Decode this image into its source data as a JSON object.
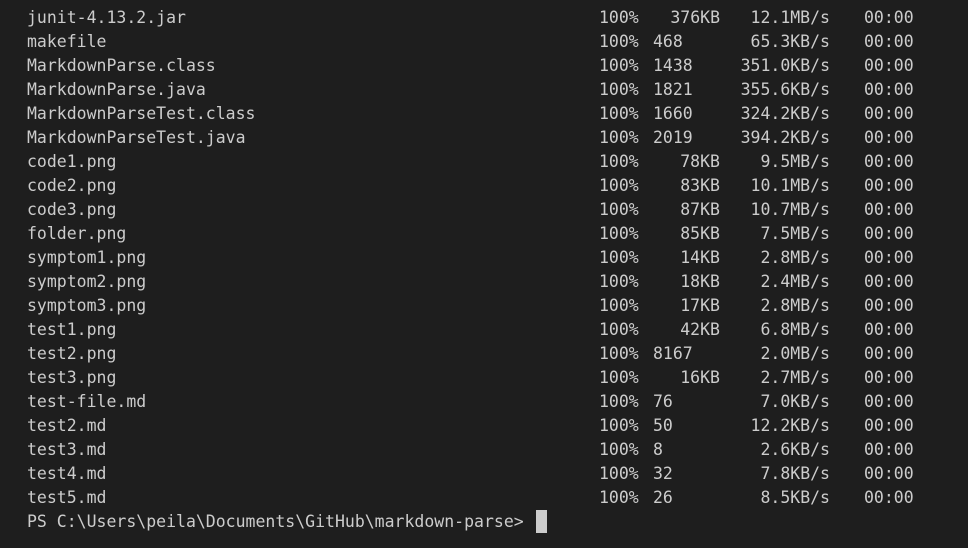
{
  "terminal": {
    "files": [
      {
        "name": "junit-4.13.2.jar",
        "percent": "100%",
        "size": "376KB",
        "rate": "12.1MB/s",
        "time": "00:00"
      },
      {
        "name": "makefile",
        "percent": "100%",
        "size": "468",
        "rate": "65.3KB/s",
        "time": "00:00"
      },
      {
        "name": "MarkdownParse.class",
        "percent": "100%",
        "size": "1438",
        "rate": "351.0KB/s",
        "time": "00:00"
      },
      {
        "name": "MarkdownParse.java",
        "percent": "100%",
        "size": "1821",
        "rate": "355.6KB/s",
        "time": "00:00"
      },
      {
        "name": "MarkdownParseTest.class",
        "percent": "100%",
        "size": "1660",
        "rate": "324.2KB/s",
        "time": "00:00"
      },
      {
        "name": "MarkdownParseTest.java",
        "percent": "100%",
        "size": "2019",
        "rate": "394.2KB/s",
        "time": "00:00"
      },
      {
        "name": "code1.png",
        "percent": "100%",
        "size": "78KB",
        "rate": "9.5MB/s",
        "time": "00:00"
      },
      {
        "name": "code2.png",
        "percent": "100%",
        "size": "83KB",
        "rate": "10.1MB/s",
        "time": "00:00"
      },
      {
        "name": "code3.png",
        "percent": "100%",
        "size": "87KB",
        "rate": "10.7MB/s",
        "time": "00:00"
      },
      {
        "name": "folder.png",
        "percent": "100%",
        "size": "85KB",
        "rate": "7.5MB/s",
        "time": "00:00"
      },
      {
        "name": "symptom1.png",
        "percent": "100%",
        "size": "14KB",
        "rate": "2.8MB/s",
        "time": "00:00"
      },
      {
        "name": "symptom2.png",
        "percent": "100%",
        "size": "18KB",
        "rate": "2.4MB/s",
        "time": "00:00"
      },
      {
        "name": "symptom3.png",
        "percent": "100%",
        "size": "17KB",
        "rate": "2.8MB/s",
        "time": "00:00"
      },
      {
        "name": "test1.png",
        "percent": "100%",
        "size": "42KB",
        "rate": "6.8MB/s",
        "time": "00:00"
      },
      {
        "name": "test2.png",
        "percent": "100%",
        "size": "8167",
        "rate": "2.0MB/s",
        "time": "00:00"
      },
      {
        "name": "test3.png",
        "percent": "100%",
        "size": "16KB",
        "rate": "2.7MB/s",
        "time": "00:00"
      },
      {
        "name": "test-file.md",
        "percent": "100%",
        "size": "76",
        "rate": "7.0KB/s",
        "time": "00:00"
      },
      {
        "name": "test2.md",
        "percent": "100%",
        "size": "50",
        "rate": "12.2KB/s",
        "time": "00:00"
      },
      {
        "name": "test3.md",
        "percent": "100%",
        "size": "8",
        "rate": "2.6KB/s",
        "time": "00:00"
      },
      {
        "name": "test4.md",
        "percent": "100%",
        "size": "32",
        "rate": "7.8KB/s",
        "time": "00:00"
      },
      {
        "name": "test5.md",
        "percent": "100%",
        "size": "26",
        "rate": "8.5KB/s",
        "time": "00:00"
      }
    ],
    "prompt": "PS C:\\Users\\peila\\Documents\\GitHub\\markdown-parse>"
  },
  "colors": {
    "background": "#1e1e1e",
    "foreground": "#cccccc"
  }
}
